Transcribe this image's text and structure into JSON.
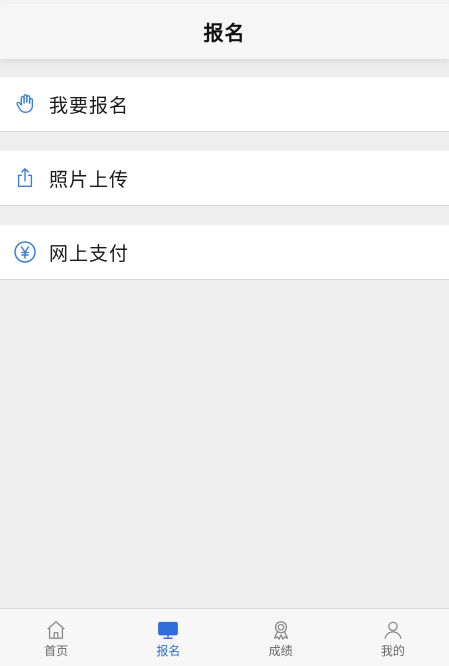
{
  "header": {
    "title": "报名"
  },
  "menu": {
    "items": [
      {
        "label": "我要报名",
        "icon": "hand-icon"
      },
      {
        "label": "照片上传",
        "icon": "upload-icon"
      },
      {
        "label": "网上支付",
        "icon": "yen-icon"
      }
    ]
  },
  "tabbar": {
    "tabs": [
      {
        "label": "首页",
        "icon": "home-icon"
      },
      {
        "label": "报名",
        "icon": "monitor-icon",
        "active": true
      },
      {
        "label": "成绩",
        "icon": "award-icon"
      },
      {
        "label": "我的",
        "icon": "person-icon"
      }
    ]
  },
  "colors": {
    "accent": "#2f6ed8",
    "icon_blue": "#3d7fd6",
    "background": "#eeeeee"
  }
}
